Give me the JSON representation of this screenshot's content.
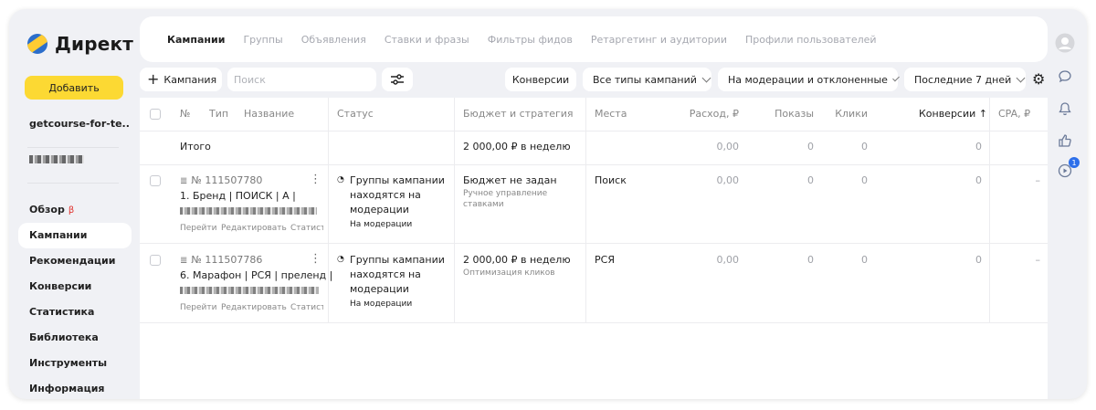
{
  "logo": {
    "text": "Директ"
  },
  "sidebar": {
    "add_label": "Добавить",
    "account": "getcourse-for-te...",
    "items": [
      {
        "label": "Обзор",
        "beta": "β"
      },
      {
        "label": "Кампании"
      },
      {
        "label": "Рекомендации"
      },
      {
        "label": "Конверсии"
      },
      {
        "label": "Статистика"
      },
      {
        "label": "Библиотека"
      },
      {
        "label": "Инструменты"
      },
      {
        "label": "Информация"
      }
    ]
  },
  "tabs": [
    "Кампании",
    "Группы",
    "Объявления",
    "Ставки и фразы",
    "Фильтры фидов",
    "Ретаргетинг и аудитории",
    "Профили пользователей"
  ],
  "toolbar": {
    "add_campaign": "Кампания",
    "search_placeholder": "Поиск",
    "conversions": "Конверсии",
    "campaign_types": "Все типы кампаний",
    "status_filter": "На модерации и отклоненные",
    "period": "Последние 7 дней"
  },
  "table": {
    "headers": {
      "num": "№",
      "type": "Тип",
      "name": "Название",
      "status": "Статус",
      "budget": "Бюджет и стратегия",
      "places": "Места",
      "spend": "Расход, ₽",
      "shows": "Показы",
      "clicks": "Клики",
      "conversions": "Конверсии ↑",
      "cpa": "CPA, ₽"
    },
    "total": {
      "label": "Итого",
      "budget": "2 000,00 ₽ в неделю",
      "spend": "0,00",
      "shows": "0",
      "clicks": "0",
      "conversions": "0"
    },
    "rows": [
      {
        "id": "№ 111507780",
        "name": "1. Бренд | ПОИСК | А |",
        "links": {
          "go": "Перейти",
          "edit": "Редактировать",
          "stats": "Статист"
        },
        "status": [
          "Группы кампании",
          "находятся на",
          "модерации"
        ],
        "status_sub": "На модерации",
        "budget": "Бюджет не задан",
        "budget_sub": [
          "Ручное управление",
          "ставками"
        ],
        "place": "Поиск",
        "spend": "0,00",
        "shows": "0",
        "clicks": "0",
        "conversions": "0",
        "cpa": "–"
      },
      {
        "id": "№ 111507786",
        "name": "6. Марафон | РСЯ | преленд |",
        "links": {
          "go": "Перейти",
          "edit": "Редактировать",
          "stats": "Статист"
        },
        "status": [
          "Группы кампании",
          "находятся на",
          "модерации"
        ],
        "status_sub": "На модерации",
        "budget": "2 000,00 ₽ в неделю",
        "budget_sub": [
          "Оптимизация кликов"
        ],
        "place": "РСЯ",
        "spend": "0,00",
        "shows": "0",
        "clicks": "0",
        "conversions": "0",
        "cpa": "–"
      }
    ]
  },
  "rail": {
    "video_badge": "1"
  },
  "colors": {
    "accent_yellow": "#fcd933",
    "badge_blue": "#2d6fea",
    "beta_red": "#e0322d"
  }
}
